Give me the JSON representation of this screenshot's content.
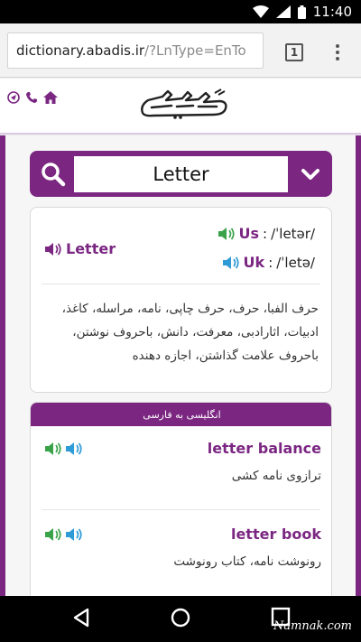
{
  "status": {
    "time": "11:40"
  },
  "browser": {
    "url_host": "dictionary.abadis.ir",
    "url_rest": "/?LnType=EnTo",
    "tab_count": "1"
  },
  "site": {
    "logo_alt": "abadis"
  },
  "search": {
    "value": "Letter"
  },
  "word": {
    "title": "Letter",
    "us_label": "Us",
    "us_sep": ":",
    "us_pron": "/ˈletər/",
    "uk_label": "Uk",
    "uk_sep": ":",
    "uk_pron": "/ˈletə/",
    "meaning": "حرف الفبا، حرف، حرف چاپی، نامه، مراسله، کاغذ، ادبیات، اثارادبی، معرفت، دانش، باحروف نوشتن، باحروف علامت گذاشتن، اجازه دهنده"
  },
  "related": {
    "header": "انگلیسی به فارسی",
    "entries": [
      {
        "title": "letter balance",
        "meaning": "ترازوی نامه کشی"
      },
      {
        "title": "letter book",
        "meaning": "رونوشت نامه، کتاب رونوشت"
      }
    ]
  },
  "watermark": "Namnak.com",
  "colors": {
    "brand": "#7b2782",
    "speaker_green": "#3aa34a",
    "speaker_blue": "#2f9bd6"
  }
}
